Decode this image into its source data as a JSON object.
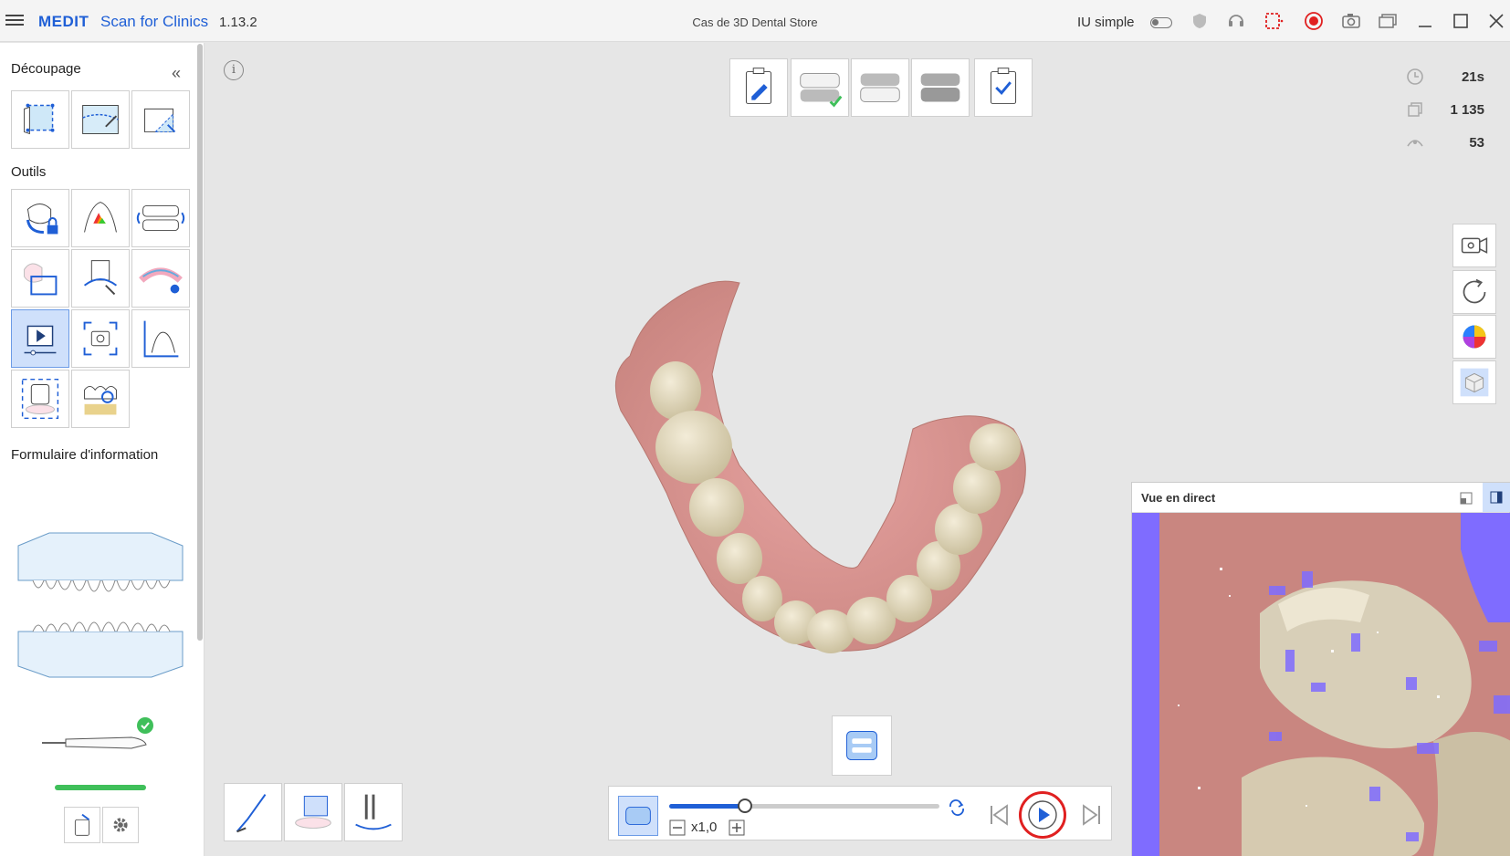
{
  "titlebar": {
    "brand": "MEDIT",
    "app_name": "Scan for Clinics",
    "version": "1.13.2",
    "window_title": "Cas de 3D Dental Store",
    "simple_ui_label": "IU simple"
  },
  "sidebar": {
    "section_cut": "Découpage",
    "section_tools": "Outils",
    "section_form": "Formulaire d'information"
  },
  "stats": {
    "time": "21s",
    "frames": "1 135",
    "count": "53"
  },
  "live_view": {
    "title": "Vue en direct"
  },
  "player": {
    "speed": "x1,0",
    "progress": 0.28
  },
  "colors": {
    "accent": "#1f5fd6",
    "active_tool": "#cfe0fb",
    "ok_green": "#3fbf5a",
    "record_red": "#e02020",
    "live_overlay": "#7f6cff"
  },
  "icons": [
    "menu-icon",
    "record-icon",
    "camera-icon",
    "play-icon",
    "settings-icon"
  ]
}
